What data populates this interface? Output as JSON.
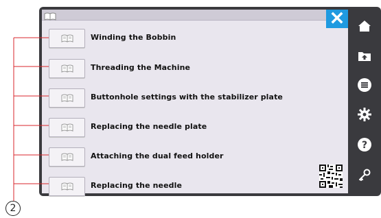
{
  "manual_items": [
    {
      "label": "Winding the Bobbin"
    },
    {
      "label": "Threading the Machine"
    },
    {
      "label": "Buttonhole settings with the stabilizer plate"
    },
    {
      "label": "Replacing the needle plate"
    },
    {
      "label": "Attaching the dual feed holder"
    },
    {
      "label": "Replacing the needle"
    }
  ],
  "callout": {
    "number": "2"
  },
  "icons": {
    "title": "book-icon",
    "close": "close-icon",
    "item_button": "book-icon",
    "qr": "qr-code-icon",
    "sidebar": [
      "home-icon",
      "folder-up-icon",
      "menu-icon",
      "gear-icon",
      "help-icon",
      "key-icon"
    ]
  },
  "colors": {
    "accent": "#1f9ae0",
    "frame": "#3a3a3e",
    "screen": "#e9e6ee",
    "callout_line": "#d9252b"
  }
}
